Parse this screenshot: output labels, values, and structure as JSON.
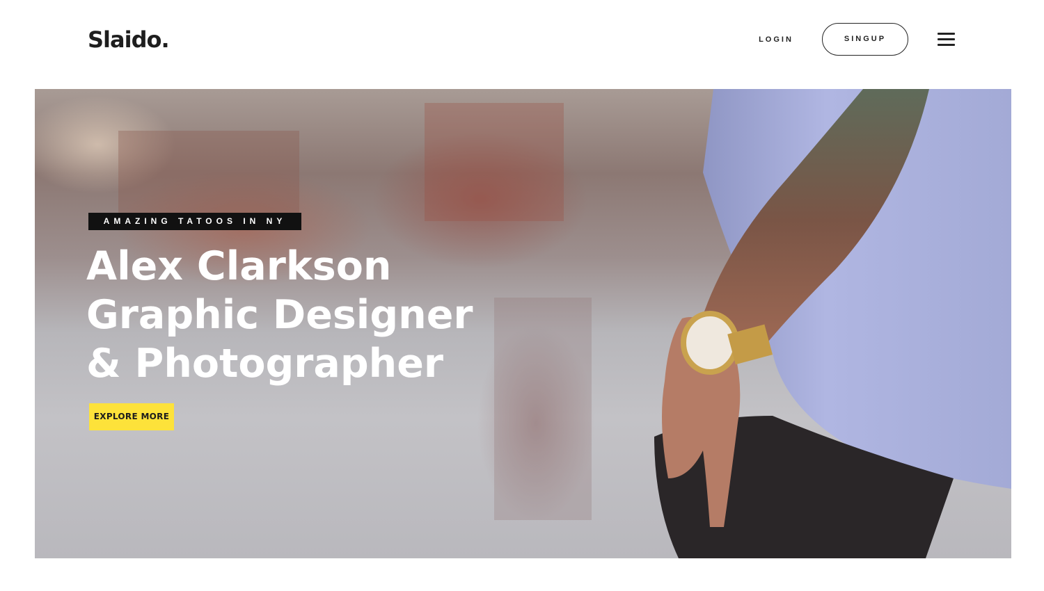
{
  "header": {
    "logo": "Slaido.",
    "login_label": "LOGIN",
    "signup_label": "SINGUP"
  },
  "hero": {
    "tagline": "AMAZING TATOOS IN NY",
    "headline_lines": [
      "Alex Clarkson",
      "Graphic Designer",
      "& Photographer"
    ],
    "cta_label": "EXPLORE MORE"
  },
  "colors": {
    "accent": "#fde23a",
    "dark": "#111111",
    "text": "#222222"
  },
  "icons": {
    "menu": "hamburger-menu-icon"
  }
}
